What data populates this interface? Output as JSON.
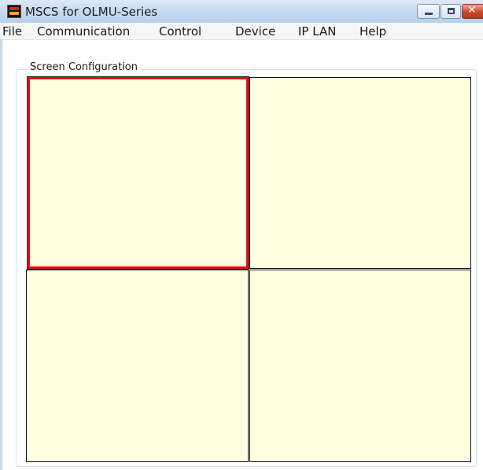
{
  "window": {
    "title": "MSCS for OLMU-Series",
    "icon": "app-icon",
    "controls": [
      "minimize-icon",
      "maximize-icon",
      "close-icon"
    ]
  },
  "menu": {
    "items": [
      "File",
      "Communication",
      "Control",
      "Device",
      "IP LAN",
      "Help"
    ]
  },
  "screen_config": {
    "label": "Screen Configuration",
    "panes": [
      {
        "id": "top-left",
        "selected": true
      },
      {
        "id": "top-right",
        "selected": false
      },
      {
        "id": "bottom-left",
        "selected": false
      },
      {
        "id": "bottom-right",
        "selected": false
      }
    ]
  },
  "colors": {
    "pane_fill": "#ffffe1",
    "selected_border": "#e01010"
  }
}
